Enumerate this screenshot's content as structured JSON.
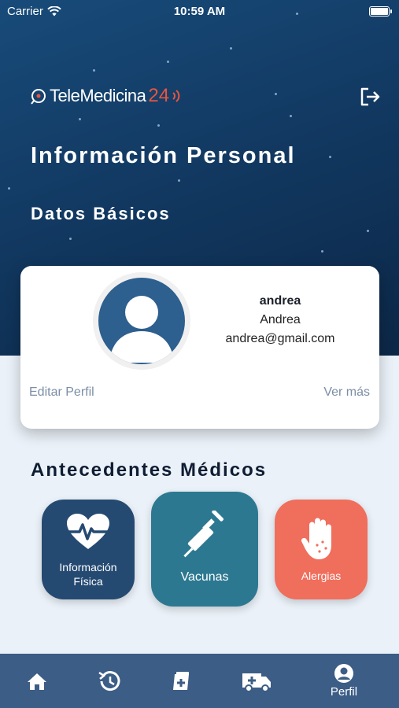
{
  "status_bar": {
    "carrier": "Carrier",
    "time": "10:59 AM",
    "battery_level": 1.0
  },
  "header": {
    "logo_brand": "TeleMedicina",
    "logo_number": "24",
    "logout_icon": "logout-icon"
  },
  "page": {
    "title": "Información Personal",
    "section_title": "Datos Básicos"
  },
  "profile": {
    "username": "andrea",
    "name": "Andrea",
    "email": "andrea@gmail.com",
    "edit_label": "Editar Perfil",
    "more_label": "Ver más"
  },
  "antecedentes": {
    "title": "Antecedentes Médicos",
    "tiles": [
      {
        "label_line1": "Información",
        "label_line2": "Física",
        "icon": "heartbeat-icon",
        "color": "#254a72"
      },
      {
        "label": "Vacunas",
        "icon": "syringe-icon",
        "color": "#2d7891"
      },
      {
        "label": "Alergias",
        "icon": "allergy-hand-icon",
        "color": "#f06e5c"
      }
    ]
  },
  "tabbar": {
    "items": [
      {
        "icon": "home-icon",
        "label": ""
      },
      {
        "icon": "history-icon",
        "label": ""
      },
      {
        "icon": "prescription-icon",
        "label": ""
      },
      {
        "icon": "ambulance-icon",
        "label": ""
      },
      {
        "icon": "profile-icon",
        "label": "Perfil"
      }
    ]
  },
  "colors": {
    "hero_dark": "#0c2747",
    "hero_light": "#184b7a",
    "accent": "#e8553f",
    "tabbar": "#3c5d86",
    "background": "#eaf1f8"
  }
}
